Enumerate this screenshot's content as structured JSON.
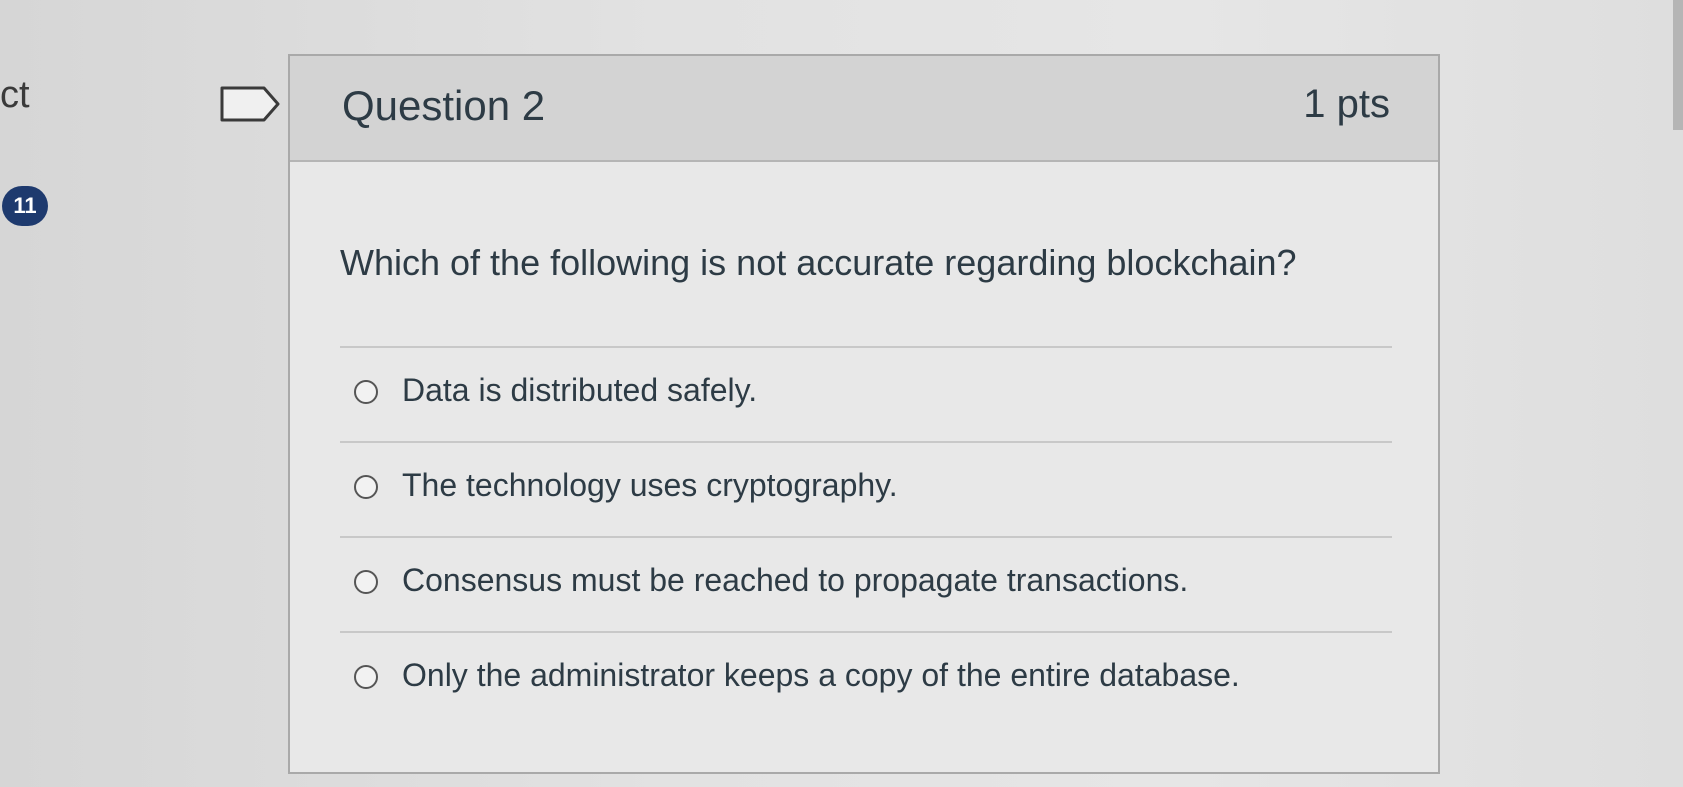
{
  "sidebar": {
    "partial_text": "ct",
    "badge_count": "11"
  },
  "question": {
    "title": "Question 2",
    "points": "1 pts",
    "prompt": "Which of the following is not accurate regarding blockchain?",
    "answers": [
      {
        "label": "Data is distributed safely.",
        "selected": false
      },
      {
        "label": "The technology uses cryptography.",
        "selected": false
      },
      {
        "label": "Consensus must be reached to propagate transactions.",
        "selected": false
      },
      {
        "label": "Only the administrator keeps a copy of the entire database.",
        "selected": false
      }
    ]
  },
  "icons": {
    "flag": "flag-icon"
  },
  "colors": {
    "badge": "#1e3a6e",
    "header": "#d3d3d3",
    "text": "#2d3b45"
  }
}
